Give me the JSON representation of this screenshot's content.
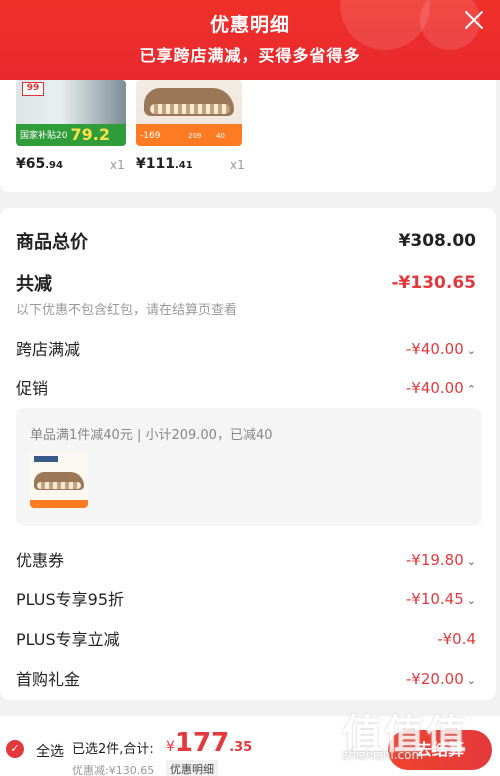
{
  "header": {
    "title": "优惠明细",
    "subtitle": "已享跨店满减，买得多省得多"
  },
  "products": [
    {
      "price_int": "¥65",
      "price_dec": ".94",
      "qty": "x1",
      "badge_top": "99",
      "badge_text": "国家补贴20",
      "badge_price": "79.2"
    },
    {
      "price_int": "¥111",
      "price_dec": ".41",
      "qty": "x1",
      "badge_price": "-169",
      "badge_nums_a": "209",
      "badge_nums_b": "40"
    }
  ],
  "summary": {
    "goods_total_label": "商品总价",
    "goods_total_value": "¥308.00",
    "total_off_label": "共减",
    "total_off_value": "-¥130.65",
    "note": "以下优惠不包含红包，请在结算页查看",
    "cross_store_label": "跨店满减",
    "cross_store_value": "-¥40.00",
    "promo_label": "促销",
    "promo_value": "-¥40.00",
    "promo_detail": "单品满1件减40元 | 小计209.00，已减40",
    "coupon_label": "优惠券",
    "coupon_value": "-¥19.80",
    "plus95_label": "PLUS专享95折",
    "plus95_value": "-¥10.45",
    "plus_off_label": "PLUS专享立减",
    "plus_off_value": "-¥0.4",
    "first_gift_label": "首购礼金",
    "first_gift_value": "-¥20.00"
  },
  "bottom": {
    "select_all": "全选",
    "selected_count": "已选2件,合计:",
    "total_currency": "¥",
    "total_int": "177",
    "total_dec": ".35",
    "discount": "优惠减:¥130.65",
    "detail": "优惠明细",
    "checkout": "去结算"
  },
  "watermark": {
    "glyphs": "值值值",
    "url": "zhizhizhi.com"
  },
  "icons": {
    "close": "close-icon",
    "check": "checkmark-icon",
    "chevron_down": "chevron-down-icon",
    "chevron_up": "chevron-up-icon"
  },
  "colors": {
    "brand_red": "#e4393c",
    "header_red": "#f0302a"
  }
}
